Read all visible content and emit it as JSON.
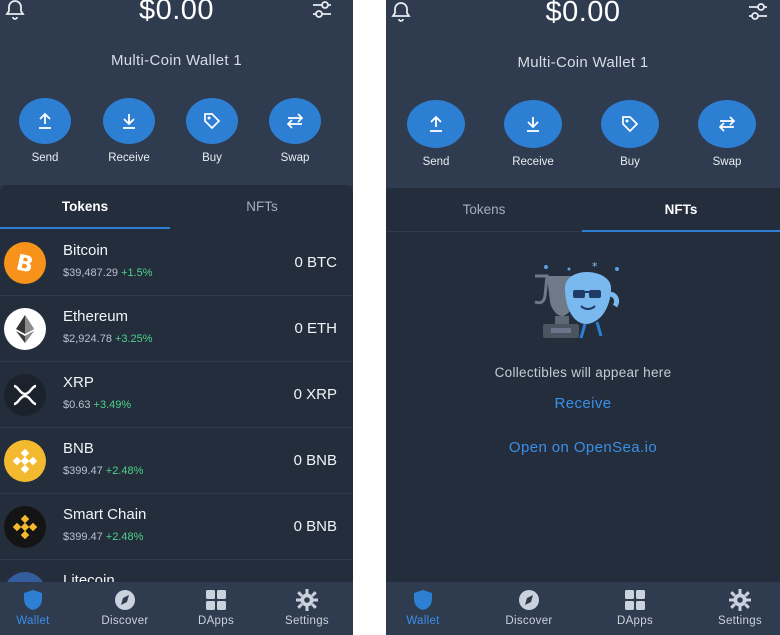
{
  "left": {
    "balance": "$0.00",
    "wallet_name": "Multi-Coin Wallet 1",
    "actions": [
      {
        "label": "Send",
        "icon": "arrow-up-icon"
      },
      {
        "label": "Receive",
        "icon": "arrow-down-icon"
      },
      {
        "label": "Buy",
        "icon": "tag-icon"
      },
      {
        "label": "Swap",
        "icon": "swap-icon"
      }
    ],
    "tabs": [
      {
        "label": "Tokens",
        "active": true
      },
      {
        "label": "NFTs",
        "active": false
      }
    ],
    "tokens": [
      {
        "name": "Bitcoin",
        "price": "$39,487.29",
        "change": "+1.5%",
        "balance": "0 BTC",
        "color": "#f7931a"
      },
      {
        "name": "Ethereum",
        "price": "$2,924.78",
        "change": "+3.25%",
        "balance": "0 ETH",
        "color": "#ffffff"
      },
      {
        "name": "XRP",
        "price": "$0.63",
        "change": "+3.49%",
        "balance": "0 XRP",
        "color": "#23292f"
      },
      {
        "name": "BNB",
        "price": "$399.47",
        "change": "+2.48%",
        "balance": "0 BNB",
        "color": "#f3ba2f"
      },
      {
        "name": "Smart Chain",
        "price": "$399.47",
        "change": "+2.48%",
        "balance": "0 BNB",
        "color": "#1a1a1a"
      },
      {
        "name": "Litecoin",
        "price": "",
        "change": "",
        "balance": "",
        "color": "#345d9d"
      }
    ]
  },
  "right": {
    "balance": "$0.00",
    "wallet_name": "Multi-Coin Wallet 1",
    "actions": [
      {
        "label": "Send",
        "icon": "arrow-up-icon"
      },
      {
        "label": "Receive",
        "icon": "arrow-down-icon"
      },
      {
        "label": "Buy",
        "icon": "tag-icon"
      },
      {
        "label": "Swap",
        "icon": "swap-icon"
      }
    ],
    "tabs": [
      {
        "label": "Tokens",
        "active": false
      },
      {
        "label": "NFTs",
        "active": true
      }
    ],
    "empty_message": "Collectibles will appear here",
    "receive_link": "Receive",
    "opensea_link": "Open on OpenSea.io"
  },
  "nav": [
    {
      "label": "Wallet",
      "icon": "shield-icon",
      "active": true
    },
    {
      "label": "Discover",
      "icon": "compass-icon",
      "active": false
    },
    {
      "label": "DApps",
      "icon": "grid-icon",
      "active": false
    },
    {
      "label": "Settings",
      "icon": "gear-icon",
      "active": false
    }
  ],
  "colors": {
    "accent": "#2d7fd3",
    "positive": "#4fd18b",
    "background": "#232d3b",
    "header": "#2f3b4e"
  }
}
